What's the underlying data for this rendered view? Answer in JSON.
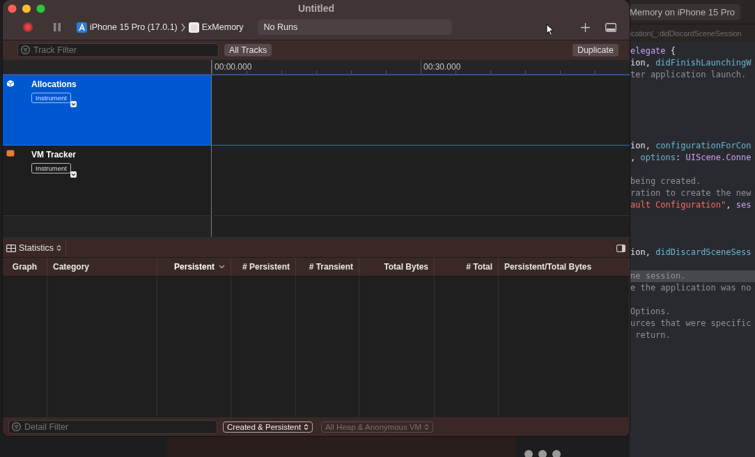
{
  "window": {
    "title": "Untitled"
  },
  "toolbar": {
    "device": "iPhone 15 Pro (17.0.1)",
    "target": "ExMemory",
    "run_status": "No Runs"
  },
  "filter_bar": {
    "track_filter": {
      "placeholder": "Track Filter"
    },
    "all_tracks": "All Tracks",
    "duplicate": "Duplicate"
  },
  "ruler": {
    "marks": [
      "00:00.000",
      "00:30.000"
    ]
  },
  "tracks": [
    {
      "name": "Allocations",
      "badge": "Instrument",
      "kind": "cube",
      "selected": true
    },
    {
      "name": "VM Tracker",
      "badge": "Instrument",
      "kind": "block",
      "selected": false
    }
  ],
  "detail": {
    "view": "Statistics",
    "columns": [
      {
        "label": "Graph",
        "sorted": false
      },
      {
        "label": "Category",
        "sorted": false
      },
      {
        "label": "Persistent",
        "sorted": true
      },
      {
        "label": "# Persistent",
        "sorted": false
      },
      {
        "label": "# Transient",
        "sorted": false
      },
      {
        "label": "Total Bytes",
        "sorted": false
      },
      {
        "label": "# Total",
        "sorted": false
      },
      {
        "label": "Persistent/Total Bytes",
        "sorted": false
      }
    ]
  },
  "bottom_bar": {
    "detail_filter": {
      "placeholder": "Detail Filter"
    },
    "popups": [
      {
        "label": "Created & Persistent",
        "disabled": false
      },
      {
        "label": "All Heap & Anonymous VM",
        "disabled": true
      }
    ]
  },
  "background": {
    "tab": "Memory on iPhone 15 Pro",
    "breadcrumb": "ication(_:didDiscardSceneSession",
    "code_lines": [
      {
        "kind": "code",
        "highlighted": false,
        "segments": [
          {
            "text": "elegate",
            "kind": "type"
          },
          {
            "text": " {",
            "kind": "plain"
          }
        ]
      },
      {
        "kind": "code",
        "highlighted": false,
        "segments": [
          {
            "text": "ion, ",
            "kind": "plain"
          },
          {
            "text": "didFinishLaunchingW",
            "kind": "ident"
          }
        ]
      },
      {
        "kind": "code",
        "highlighted": false,
        "segments": [
          {
            "text": "ter application launch.",
            "kind": "comment"
          }
        ]
      },
      {
        "kind": "blank"
      },
      {
        "kind": "blank"
      },
      {
        "kind": "blank"
      },
      {
        "kind": "blank"
      },
      {
        "kind": "blank"
      },
      {
        "kind": "code",
        "highlighted": false,
        "segments": [
          {
            "text": "ion, ",
            "kind": "plain"
          },
          {
            "text": "configurationForCon",
            "kind": "ident"
          }
        ]
      },
      {
        "kind": "code",
        "highlighted": false,
        "segments": [
          {
            "text": ", ",
            "kind": "plain"
          },
          {
            "text": "options",
            "kind": "ident"
          },
          {
            "text": ": ",
            "kind": "plain"
          },
          {
            "text": "UIScene.Conne",
            "kind": "type"
          }
        ]
      },
      {
        "kind": "blank"
      },
      {
        "kind": "code",
        "highlighted": false,
        "segments": [
          {
            "text": "being created.",
            "kind": "comment"
          }
        ]
      },
      {
        "kind": "code",
        "highlighted": false,
        "segments": [
          {
            "text": "ration to create the new",
            "kind": "comment"
          }
        ]
      },
      {
        "kind": "code",
        "highlighted": false,
        "segments": [
          {
            "text": "ault Configuration\"",
            "kind": "string"
          },
          {
            "text": ", ",
            "kind": "plain"
          },
          {
            "text": "ses",
            "kind": "type"
          }
        ]
      },
      {
        "kind": "blank"
      },
      {
        "kind": "blank"
      },
      {
        "kind": "blank"
      },
      {
        "kind": "code",
        "highlighted": false,
        "segments": [
          {
            "text": "ion, ",
            "kind": "plain"
          },
          {
            "text": "didDiscardSceneSess",
            "kind": "ident"
          }
        ]
      },
      {
        "kind": "blank"
      },
      {
        "kind": "code",
        "highlighted": true,
        "segments": [
          {
            "text": "ne session.",
            "kind": "comment"
          }
        ]
      },
      {
        "kind": "code",
        "highlighted": false,
        "segments": [
          {
            "text": "e the application was no",
            "kind": "comment"
          }
        ]
      },
      {
        "kind": "blank"
      },
      {
        "kind": "code",
        "highlighted": false,
        "segments": [
          {
            "text": "Options.",
            "kind": "comment"
          }
        ]
      },
      {
        "kind": "code",
        "highlighted": false,
        "segments": [
          {
            "text": "urces that were specific",
            "kind": "comment"
          }
        ]
      },
      {
        "kind": "code",
        "highlighted": false,
        "segments": [
          {
            "text": " return.",
            "kind": "comment"
          }
        ]
      }
    ]
  }
}
